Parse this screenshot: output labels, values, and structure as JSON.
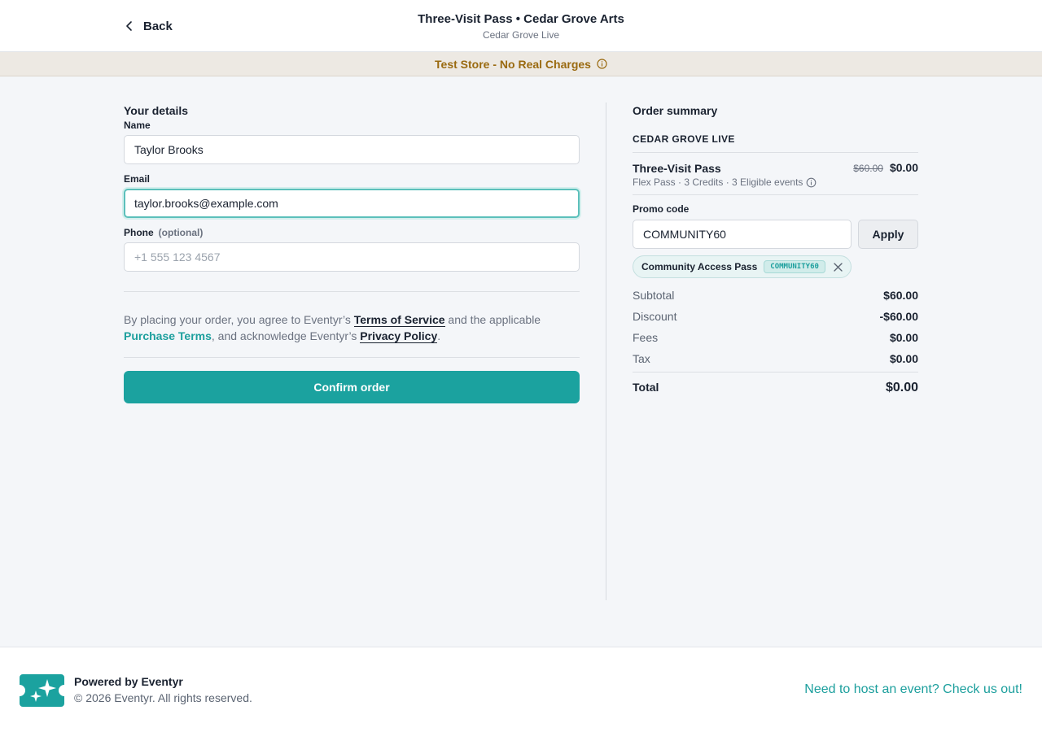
{
  "header": {
    "back_label": "Back",
    "title": "Three-Visit Pass • Cedar Grove Arts",
    "subtitle": "Cedar Grove Live"
  },
  "banner": {
    "text": "Test Store - No Real Charges",
    "icon": "info-icon"
  },
  "details": {
    "section_title": "Your details",
    "name_label": "Name",
    "name_value": "Taylor Brooks",
    "email_label": "Email",
    "email_value": "taylor.brooks@example.com",
    "phone_label": "Phone",
    "phone_optional": "(optional)",
    "phone_placeholder": "+1 555 123 4567"
  },
  "terms": {
    "part1": "By placing your order, you agree to Eventyr’s ",
    "terms_link": "Terms of Service",
    "part2": " and the applicable ",
    "purchase_link": "Purchase Terms",
    "part3": ", and acknowledge Eventyr’s ",
    "privacy_link": "Privacy Policy",
    "part4": "."
  },
  "confirm_label": "Confirm order",
  "summary": {
    "title": "Order summary",
    "organizer": "CEDAR GROVE LIVE",
    "item_name": "Three-Visit Pass",
    "item_meta": "Flex Pass · 3 Credits · 3 Eligible events",
    "price_original": "$60.00",
    "price_current": "$0.00",
    "promo_label": "Promo code",
    "promo_value": "COMMUNITY60",
    "apply_label": "Apply",
    "applied_name": "Community Access Pass",
    "applied_code": "COMMUNITY60",
    "subtotal_label": "Subtotal",
    "subtotal_value": "$60.00",
    "discount_label": "Discount",
    "discount_value": "-$60.00",
    "fees_label": "Fees",
    "fees_value": "$0.00",
    "tax_label": "Tax",
    "tax_value": "$0.00",
    "total_label": "Total",
    "total_value": "$0.00"
  },
  "footer": {
    "powered": "Powered by Eventyr",
    "copyright": "© 2026 Eventyr. All rights reserved.",
    "host_link": "Need to host an event? Check us out!"
  },
  "colors": {
    "accent": "#1ba29f",
    "banner_text": "#9a6a10",
    "banner_bg": "#ede9e3"
  }
}
